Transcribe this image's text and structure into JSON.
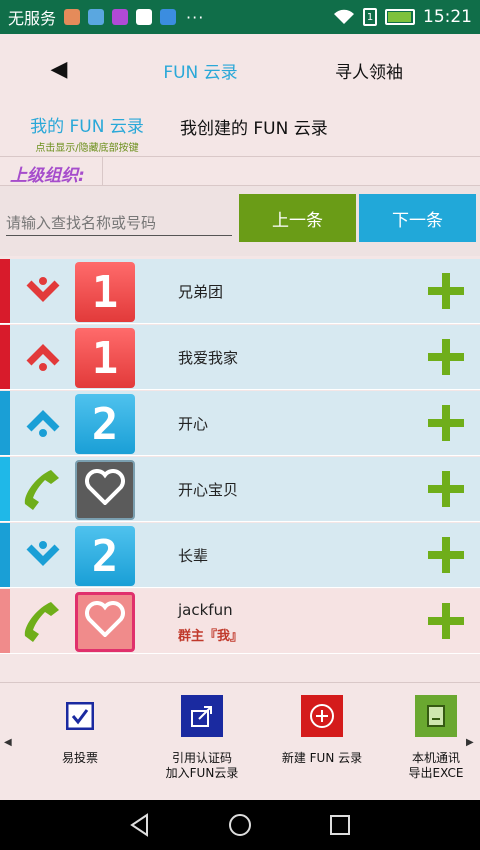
{
  "status_bar": {
    "carrier": "无服务",
    "time": "15:21",
    "more_glyph": "···",
    "sim_label": "1",
    "battery_fraction": 0.9,
    "app_icon_colors": [
      "#e58b5a",
      "#5aa7e0",
      "#b04ad6",
      "#ffffff",
      "#3b8de0"
    ]
  },
  "header": {
    "back_glyph": "◀",
    "title": "FUN 云录",
    "right_link": "寻人领袖"
  },
  "tabs": {
    "mine_label": "我的 FUN 云录",
    "mine_hint": "点击显示/隐藏底部按键",
    "created_label": "我创建的 FUN 云录"
  },
  "parent_org": {
    "label": "上级组织:"
  },
  "search": {
    "placeholder": "请输入查找名称或号码",
    "prev_label": "上一条",
    "next_label": "下一条"
  },
  "list": {
    "items": [
      {
        "name": "兄弟团",
        "tile_text": "1",
        "tile_style": "red",
        "indicator": "down-arrow-icon",
        "edge_color": "#d81b2b",
        "indicator_color": "#e23a3a",
        "subtitle": ""
      },
      {
        "name": "我爱我家",
        "tile_text": "1",
        "tile_style": "red",
        "indicator": "up-arrow-icon",
        "edge_color": "#d81b2b",
        "indicator_color": "#e23a3a",
        "subtitle": ""
      },
      {
        "name": "开心",
        "tile_text": "2",
        "tile_style": "blue",
        "indicator": "up-arrow-icon",
        "edge_color": "#1a9fd6",
        "indicator_color": "#1a9fd6",
        "subtitle": ""
      },
      {
        "name": "开心宝贝",
        "tile_text": "",
        "tile_style": "gray",
        "indicator": "phone-icon",
        "edge_color": "#1fb8e8",
        "indicator_color": "#6fae1a",
        "subtitle": ""
      },
      {
        "name": "长辈",
        "tile_text": "2",
        "tile_style": "blue",
        "indicator": "down-arrow-icon",
        "edge_color": "#1a9fd6",
        "indicator_color": "#1a9fd6",
        "subtitle": ""
      },
      {
        "name": "jackfun",
        "tile_text": "",
        "tile_style": "pinkheart",
        "indicator": "phone-icon",
        "edge_color": "#f08b8b",
        "indicator_color": "#6fae1a",
        "subtitle": "群主『我』"
      }
    ]
  },
  "toolbar": {
    "items": [
      {
        "label_1": "易投票",
        "label_2": "",
        "icon": "checkbox-icon",
        "color": "#1a2aa0"
      },
      {
        "label_1": "引用认证码",
        "label_2": "加入FUN云录",
        "icon": "share-icon",
        "color": "#1a2aa0"
      },
      {
        "label_1": "新建 FUN 云录",
        "label_2": "",
        "icon": "add-circle-icon",
        "color": "#d41b1b"
      },
      {
        "label_1": "本机通讯",
        "label_2": "导出EXCE",
        "icon": "export-icon",
        "color": "#6aa830"
      }
    ],
    "left_arrow": "◀",
    "right_arrow": "▶"
  }
}
